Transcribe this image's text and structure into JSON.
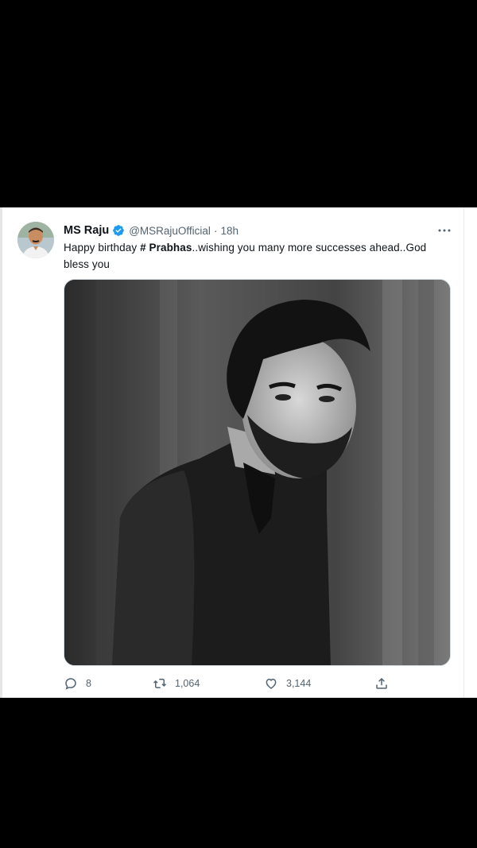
{
  "tweet": {
    "display_name": "MS Raju",
    "handle": "@MSRajuOfficial",
    "separator": "·",
    "time": "18h",
    "text_before": "Happy birthday ",
    "hashtag": "# Prabhas",
    "text_after": "..wishing you  many more successes ahead..God bless you"
  },
  "actions": {
    "reply_count": "8",
    "retweet_count": "1,064",
    "like_count": "3,144"
  },
  "icons": {
    "verified": "verified-badge-icon",
    "more": "more-options-icon",
    "reply": "reply-icon",
    "retweet": "retweet-icon",
    "like": "like-icon",
    "share": "share-icon"
  },
  "colors": {
    "verified_blue": "#1d9bf0",
    "text": "#0f1419",
    "muted": "#536471"
  }
}
